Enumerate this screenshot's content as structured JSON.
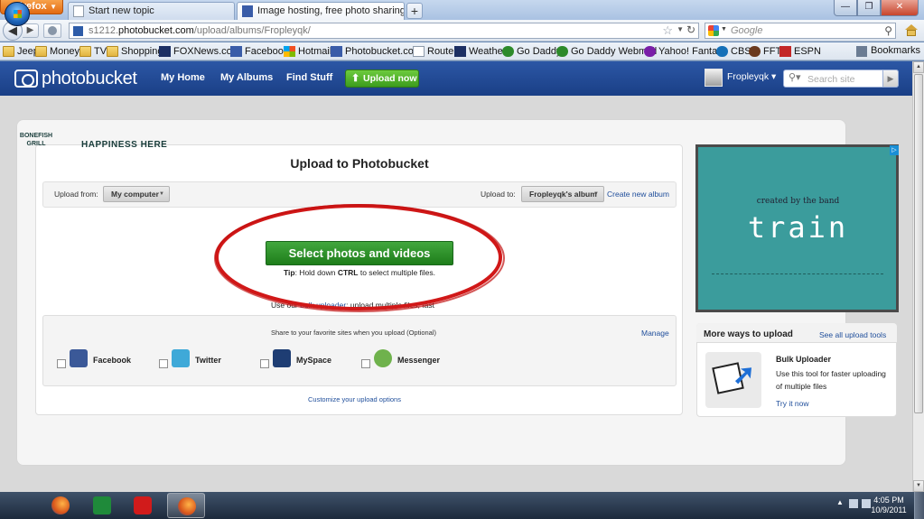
{
  "browser": {
    "menu_label": "Firefox",
    "tabs": [
      {
        "title": "Start new topic"
      },
      {
        "title": "Image hosting, free photo sharing & ..."
      }
    ],
    "url_prefix": "s1212.",
    "url_domain": "photobucket.com",
    "url_path": "/upload/albums/Fropleyqk/",
    "search_placeholder": "Google",
    "bookmarks": [
      "Jeep",
      "Money",
      "TV",
      "Shopping",
      "FOXNews.com",
      "Facebook",
      "Hotmail",
      "Photobucket.com",
      "Router",
      "Weather",
      "Go Daddy",
      "Go Daddy Webmail",
      "Yahoo! Fantasy",
      "CBS",
      "FFT",
      "ESPN"
    ],
    "bookmarks_menu": "Bookmarks"
  },
  "header": {
    "logo": "photobucket",
    "nav": [
      "My Home",
      "My Albums",
      "Find Stuff"
    ],
    "upload_now": "Upload now",
    "username": "Fropleyqk ▾",
    "search_placeholder": "Search site"
  },
  "upload": {
    "title": "Upload to Photobucket",
    "from_label": "Upload from:",
    "from_value": "My computer",
    "to_label": "Upload to:",
    "to_value": "Fropleyqk's album",
    "create_album": "Create new album",
    "select_button": "Select photos and videos",
    "tip_label": "Tip",
    "tip_pre": ": Hold down ",
    "tip_key": "CTRL",
    "tip_post": " to select multiple files.",
    "bulk_pre": "Use our ",
    "bulk_link": "bulk uploader",
    "bulk_post": ": upload multiple files, fast",
    "share_title": "Share to your favorite sites when you upload (Optional)",
    "manage": "Manage",
    "share_sites": [
      {
        "name": "Facebook",
        "color": "#3b5998"
      },
      {
        "name": "Twitter",
        "color": "#3fa9d8"
      },
      {
        "name": "MySpace",
        "color": "#1e3d73"
      },
      {
        "name": "Messenger",
        "color": "#6fb24c"
      }
    ],
    "customize": "Customize your upload options"
  },
  "ad": {
    "created": "created by the band",
    "band": "train",
    "logo": "BONEFISH GRILL",
    "slogan": "HAPPINESS HERE"
  },
  "more": {
    "title": "More ways to upload",
    "see_all": "See all upload tools",
    "bulk_title": "Bulk Uploader",
    "bulk_desc": "Use this tool for faster uploading of multiple files",
    "try_now": "Try it now"
  },
  "taskbar": {
    "time": "4:05 PM",
    "date": "10/9/2011"
  }
}
